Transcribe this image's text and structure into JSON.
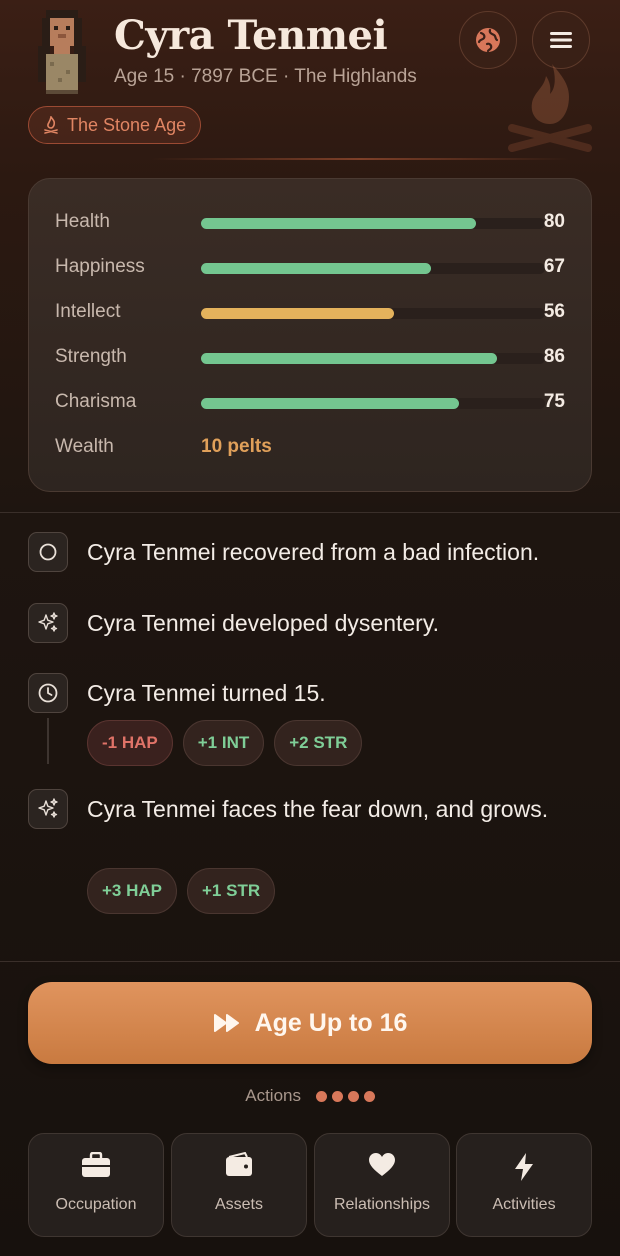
{
  "character": {
    "name": "Cyra Tenmei",
    "subline": "Age 15 · 7897 BCE · The Highlands",
    "era": "The Stone Age"
  },
  "header": {
    "globe_icon": "globe-icon",
    "menu_icon": "hamburger-menu-icon",
    "decoration_icon": "campfire-icon"
  },
  "stats": [
    {
      "label": "Health",
      "value": "80",
      "level": 80,
      "color": "#74c690"
    },
    {
      "label": "Happiness",
      "value": "67",
      "level": 67,
      "color": "#74c690"
    },
    {
      "label": "Intellect",
      "value": "56",
      "level": 56,
      "color": "#e4b25c"
    },
    {
      "label": "Strength",
      "value": "86",
      "level": 86,
      "color": "#74c690"
    },
    {
      "label": "Charisma",
      "value": "75",
      "level": 75,
      "color": "#74c690"
    }
  ],
  "wealth": {
    "label": "Wealth",
    "value": "10 pelts"
  },
  "events": [
    {
      "icon": "circle-icon",
      "text": "Cyra Tenmei recovered from a bad infection.",
      "chips": []
    },
    {
      "icon": "sparkles-icon",
      "text": "Cyra Tenmei developed dysentery.",
      "chips": []
    },
    {
      "icon": "clock-icon",
      "text": "Cyra Tenmei turned 15.",
      "chips": [
        {
          "label": "-1 HAP",
          "kind": "neg"
        },
        {
          "label": "+1 INT",
          "kind": "pos"
        },
        {
          "label": "+2 STR",
          "kind": "pos"
        }
      ]
    },
    {
      "icon": "sparkles-icon",
      "text": "Cyra Tenmei faces the fear down, and grows.",
      "chips": [
        {
          "label": "+3 HAP",
          "kind": "pos"
        },
        {
          "label": "+1 STR",
          "kind": "pos"
        }
      ]
    }
  ],
  "age_up": {
    "label": "Age Up to 16",
    "icon": "fast-forward-icon"
  },
  "actions": {
    "label": "Actions",
    "items": [
      {
        "label": "Occupation",
        "icon": "briefcase-icon"
      },
      {
        "label": "Assets",
        "icon": "wallet-icon"
      },
      {
        "label": "Relationships",
        "icon": "heart-icon"
      },
      {
        "label": "Activities",
        "icon": "lightning-icon"
      }
    ]
  },
  "colors": {
    "accent": "#d8875a",
    "positive": "#74c690",
    "negative": "#e07368",
    "wealth": "#e0a05a"
  }
}
